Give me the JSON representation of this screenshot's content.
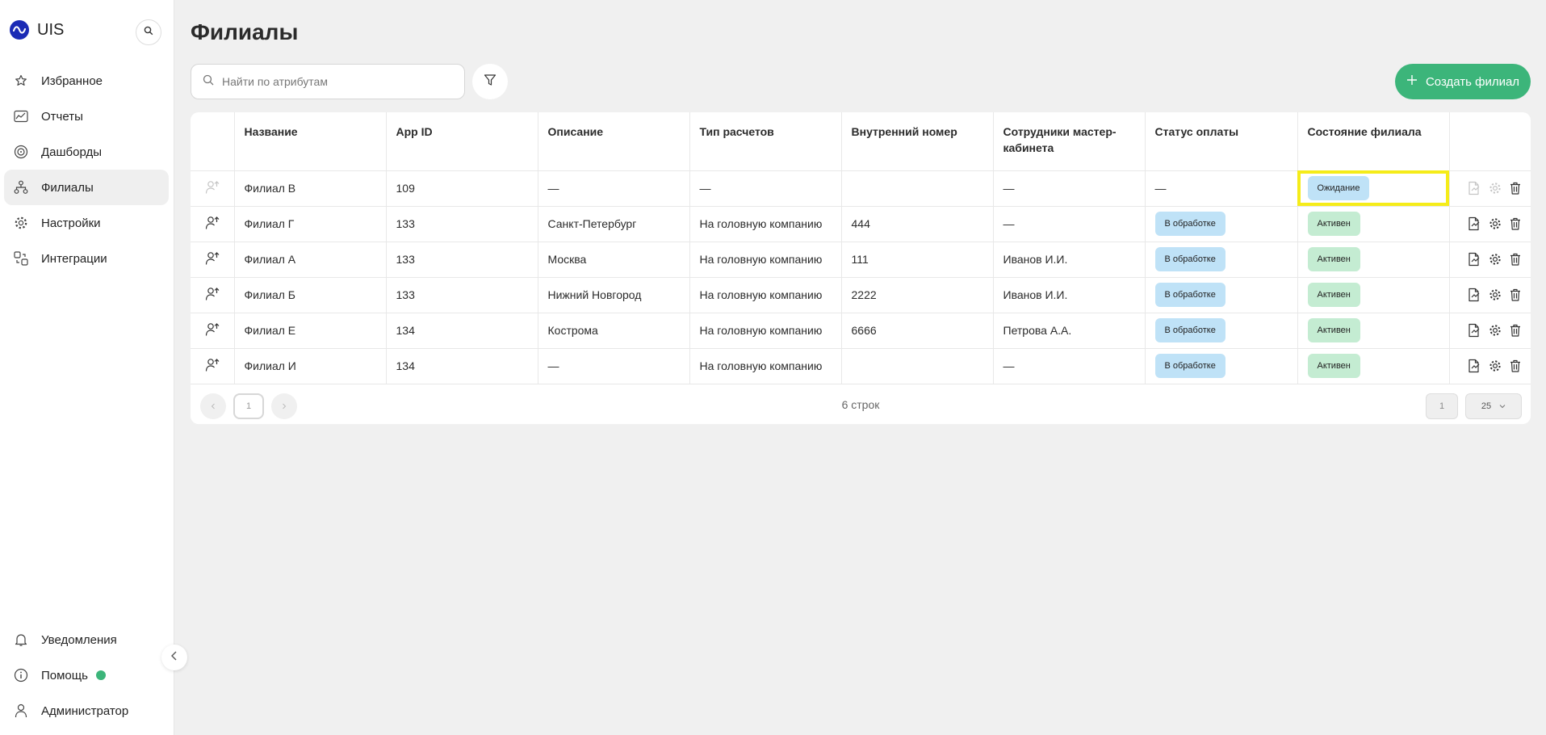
{
  "sidebar": {
    "brand": "UIS",
    "items": [
      {
        "label": "Избранное",
        "icon": "star-icon"
      },
      {
        "label": "Отчеты",
        "icon": "reports-icon"
      },
      {
        "label": "Дашборды",
        "icon": "dashboard-icon"
      },
      {
        "label": "Филиалы",
        "icon": "branches-icon",
        "active": true
      },
      {
        "label": "Настройки",
        "icon": "gear-icon"
      },
      {
        "label": "Интеграции",
        "icon": "integrations-icon"
      }
    ],
    "bottom": [
      {
        "label": "Уведомления",
        "icon": "bell-icon"
      },
      {
        "label": "Помощь",
        "icon": "info-icon"
      },
      {
        "label": "Администратор",
        "icon": "user-icon"
      }
    ]
  },
  "page": {
    "title": "Филиалы",
    "search_placeholder": "Найти по атрибутам",
    "create_label": "Создать филиал"
  },
  "table": {
    "headers": [
      "",
      "Название",
      "App ID",
      "Описание",
      "Тип расчетов",
      "Внутренний номер",
      "Сотрудники мастер-кабинета",
      "Статус оплаты",
      "Состояние филиала",
      ""
    ],
    "rows": [
      {
        "name": "Филиал В",
        "app_id": "109",
        "desc": "—",
        "calc": "—",
        "inner": "",
        "staff": "—",
        "pay": "—",
        "state": "Ожидание",
        "disabled": true
      },
      {
        "name": "Филиал Г",
        "app_id": "133",
        "desc": "Санкт-Петербург",
        "calc": "На головную компанию",
        "inner": "444",
        "staff": "—",
        "pay": "В обработке",
        "state": "Активен"
      },
      {
        "name": "Филиал А",
        "app_id": "133",
        "desc": "Москва",
        "calc": "На головную компанию",
        "inner": "111",
        "staff": "Иванов И.И.",
        "pay": "В обработке",
        "state": "Активен"
      },
      {
        "name": "Филиал Б",
        "app_id": "133",
        "desc": "Нижний Новгород",
        "calc": "На головную компанию",
        "inner": "2222",
        "staff": "Иванов И.И.",
        "pay": "В обработке",
        "state": "Активен"
      },
      {
        "name": "Филиал Е",
        "app_id": "134",
        "desc": "Кострома",
        "calc": "На головную компанию",
        "inner": "6666",
        "staff": "Петрова А.А.",
        "pay": "В обработке",
        "state": "Активен"
      },
      {
        "name": "Филиал И",
        "app_id": "134",
        "desc": "—",
        "calc": "На головную компанию",
        "inner": "",
        "staff": "—",
        "pay": "В обработке",
        "state": "Активен"
      }
    ]
  },
  "pagination": {
    "current_page": "1",
    "rows_count": "6 строк",
    "page_input": "1",
    "page_size": "25"
  },
  "colors": {
    "accent": "#3cb57a",
    "badge_blue": "#bfe2f7",
    "badge_green": "#c4ecd2",
    "highlight": "#f5ec1a",
    "logo": "#1b2bb5"
  }
}
